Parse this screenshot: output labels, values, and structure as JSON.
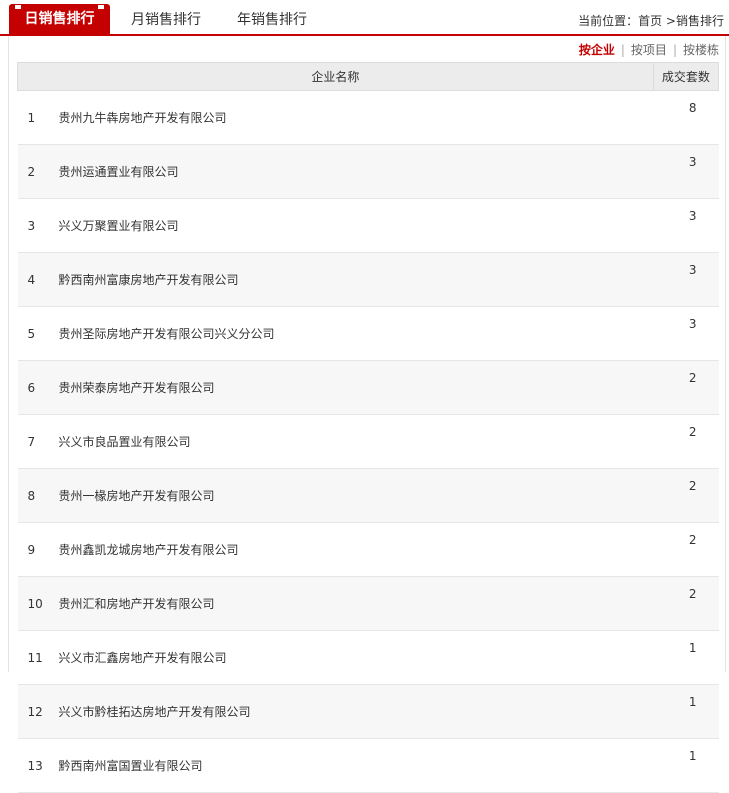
{
  "tabs": [
    {
      "label": "日销售排行",
      "active": true
    },
    {
      "label": "月销售排行",
      "active": false
    },
    {
      "label": "年销售排行",
      "active": false
    }
  ],
  "breadcrumb": {
    "prefix": "当前位置：",
    "home": "首页",
    "separator": " >",
    "current": "销售排行"
  },
  "sort_options": [
    {
      "label": "按企业",
      "active": true
    },
    {
      "label": "按项目",
      "active": false
    },
    {
      "label": "按楼栋",
      "active": false
    }
  ],
  "sort_separator": "|",
  "table": {
    "headers": [
      "企业名称",
      "成交套数"
    ],
    "rows": [
      {
        "rank": "1",
        "name": "贵州九牛犇房地产开发有限公司",
        "count": "8"
      },
      {
        "rank": "2",
        "name": "贵州运通置业有限公司",
        "count": "3"
      },
      {
        "rank": "3",
        "name": "兴义万聚置业有限公司",
        "count": "3"
      },
      {
        "rank": "4",
        "name": "黔西南州富康房地产开发有限公司",
        "count": "3"
      },
      {
        "rank": "5",
        "name": "贵州圣际房地产开发有限公司兴义分公司",
        "count": "3"
      },
      {
        "rank": "6",
        "name": "贵州荣泰房地产开发有限公司",
        "count": "2"
      },
      {
        "rank": "7",
        "name": "兴义市良品置业有限公司",
        "count": "2"
      },
      {
        "rank": "8",
        "name": "贵州一椽房地产开发有限公司",
        "count": "2"
      },
      {
        "rank": "9",
        "name": "贵州鑫凯龙城房地产开发有限公司",
        "count": "2"
      },
      {
        "rank": "10",
        "name": "贵州汇和房地产开发有限公司",
        "count": "2"
      },
      {
        "rank": "11",
        "name": "兴义市汇鑫房地产开发有限公司",
        "count": "1"
      },
      {
        "rank": "12",
        "name": "兴义市黔桂拓达房地产开发有限公司",
        "count": "1"
      },
      {
        "rank": "13",
        "name": "黔西南州富国置业有限公司",
        "count": "1"
      }
    ]
  },
  "colors": {
    "accent": "#c40000"
  }
}
